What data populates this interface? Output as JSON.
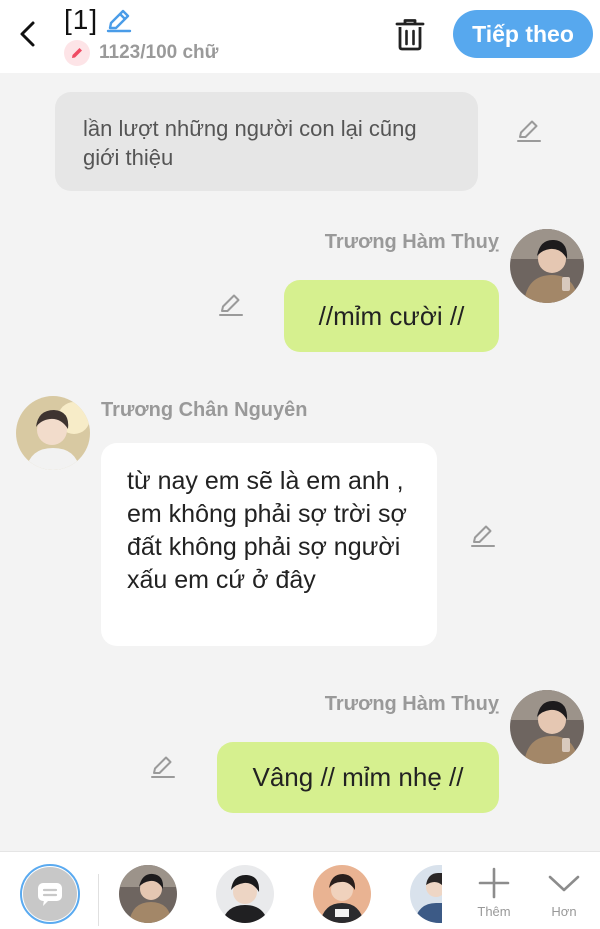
{
  "header": {
    "title": "[1]",
    "word_count": "1123/100 chữ",
    "next_button": "Tiếp theo",
    "icons": {
      "back": "chevron-left-icon",
      "title_edit": "pencil-icon",
      "count": "pencil-icon",
      "delete": "trash-icon"
    }
  },
  "messages": [
    {
      "type": "narration",
      "text": "lần lượt những người con lại cũng giới thiệu"
    },
    {
      "type": "dialogue",
      "side": "right",
      "speaker": "Trương Hàm Thuỵ",
      "text": "//mỉm cười //"
    },
    {
      "type": "dialogue",
      "side": "left",
      "speaker": "Trương Chân Nguyên",
      "text": "từ nay em sẽ là em anh , em không phải sợ trời sợ đất không phải sợ người xấu em cứ ở đây"
    },
    {
      "type": "dialogue",
      "side": "right",
      "speaker": "Trương Hàm Thuỵ",
      "text": "Vâng // mỉm nhẹ //"
    }
  ],
  "bottom_bar": {
    "add_label": "Thêm",
    "more_label": "Hơn",
    "icons": {
      "narrator": "chat-bubble-icon",
      "add": "plus-icon",
      "more": "chevron-down-icon"
    }
  },
  "colors": {
    "accent": "#57a8ee",
    "bubble_green": "#d6f08f",
    "narration_bg": "#e6e6e6",
    "background": "#f3f3f3"
  }
}
